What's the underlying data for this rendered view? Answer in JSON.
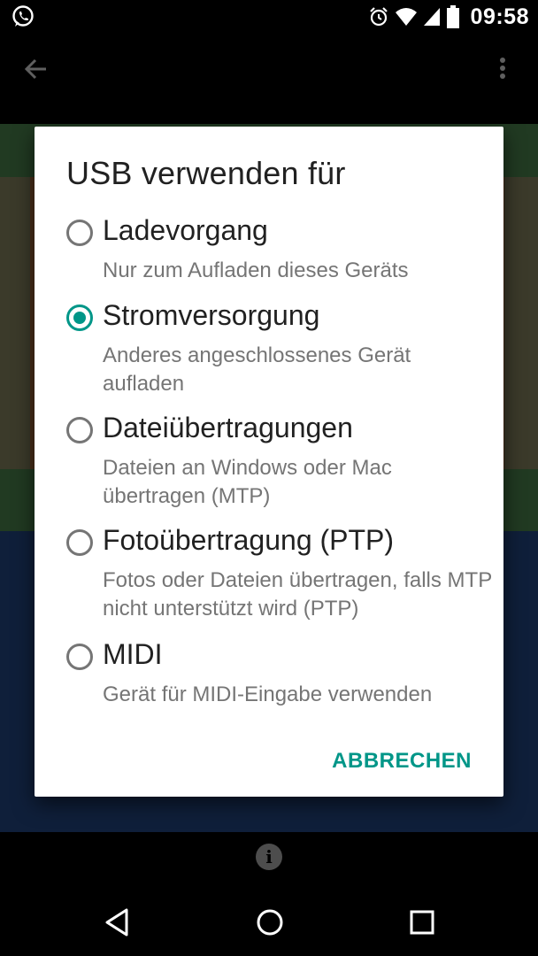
{
  "status_bar": {
    "time": "09:58",
    "icons": [
      "whatsapp-icon",
      "alarm-icon",
      "wifi-icon",
      "signal-icon",
      "battery-icon"
    ]
  },
  "app_bar": {
    "icons": [
      "arrow-back-icon",
      "more-vert-icon"
    ]
  },
  "dialog": {
    "title": "USB verwenden für",
    "options": [
      {
        "title": "Ladevorgang",
        "description": "Nur zum Aufladen dieses Geräts",
        "selected": false
      },
      {
        "title": "Stromversorgung",
        "description": "Anderes angeschlossenes Gerät aufladen",
        "selected": true
      },
      {
        "title": "Dateiübertragungen",
        "description": "Dateien an Windows oder Mac übertragen (MTP)",
        "selected": false
      },
      {
        "title": "Fotoübertragung (PTP)",
        "description": "Fotos oder Dateien übertragen, falls MTP nicht unterstützt wird (PTP)",
        "selected": false
      },
      {
        "title": "MIDI",
        "description": "Gerät für MIDI-Eingabe verwenden",
        "selected": false
      }
    ],
    "cancel_label": "ABBRECHEN"
  },
  "info_button": {
    "glyph": "i"
  },
  "colors": {
    "accent": "#009688",
    "title_text": "#212121",
    "secondary_text": "#757575"
  }
}
